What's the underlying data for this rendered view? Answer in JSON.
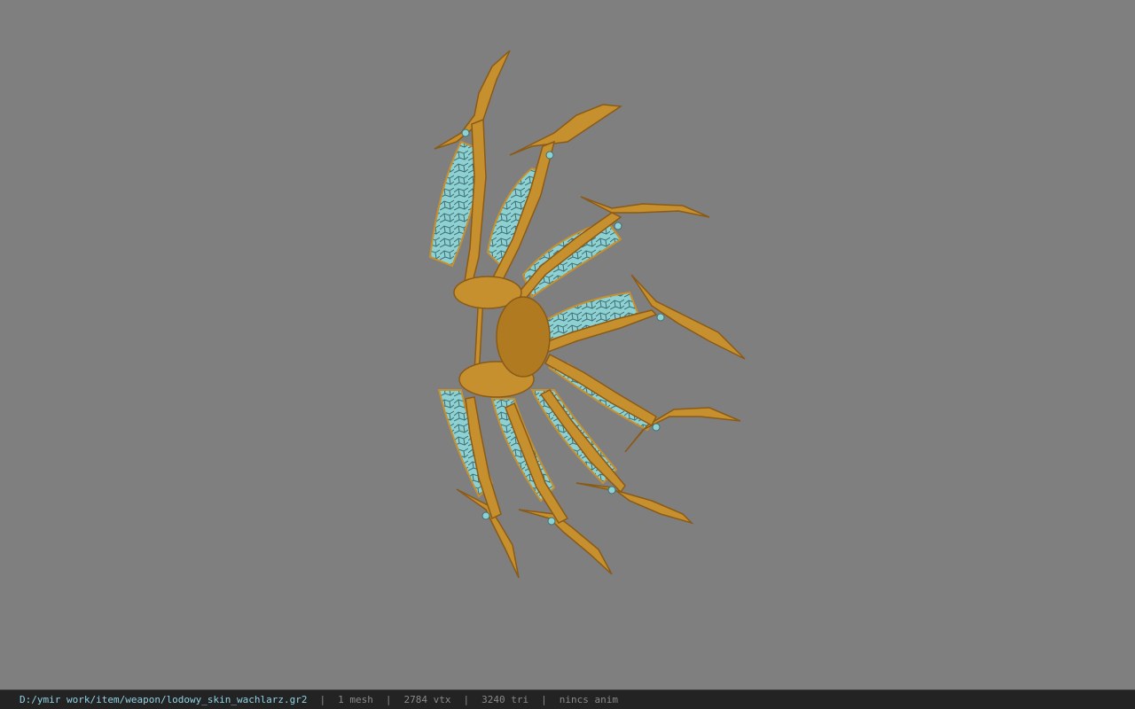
{
  "viewport": {
    "background_color": "#7f7f7f",
    "model": {
      "icon": "ice-fan-weapon-model",
      "gold_color": "#c7902e",
      "gold_dark_color": "#8a5a17",
      "ice_color": "#8ed1d3",
      "ice_dark_color": "#3f6e72"
    }
  },
  "status_bar": {
    "file_path": "D:/ymir work/item/weapon/lodowy_skin_wachlarz.gr2",
    "separator": "|",
    "mesh_count": "1 mesh",
    "vertex_count": "2784 vtx",
    "triangle_count": "3240 tri",
    "anim_status": "nincs anim",
    "path_color": "#8fd3e6",
    "text_color": "#8a8a8a"
  }
}
